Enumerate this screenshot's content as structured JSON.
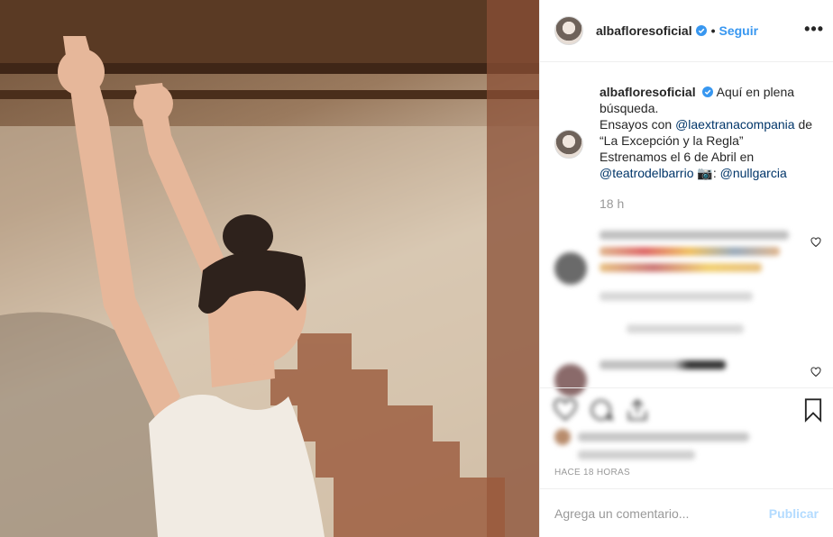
{
  "post": {
    "photo": {
      "subject": "dancer-stretching-arms"
    },
    "header": {
      "username": "albafloresoficial",
      "verified": true,
      "separator": "•",
      "follow_label": "Seguir",
      "more_label": "•••"
    },
    "caption": {
      "username": "albafloresoficial",
      "line1": "Aquí en plena búsqueda.",
      "line2_prefix": "Ensayos con ",
      "mention1": "@laextranacompania",
      "line2_suffix": " de",
      "line3": "“La Excepción y la Regla”",
      "line4": "Estrenamos el 6 de Abril en",
      "mention2": "@teatrodelbarrio",
      "camera_glyph": "📷",
      "credit_sep": ": ",
      "mention3": "@nullgarcia",
      "time": "18 h"
    },
    "footer": {
      "timestamp": "Hace 18 horas",
      "comment_placeholder": "Agrega un comentario...",
      "publish_label": "Publicar"
    },
    "colors": {
      "link": "#3897f0",
      "mention": "#003569",
      "muted": "#999999",
      "publish_disabled": "#b3dbff",
      "border": "#efefef"
    }
  }
}
